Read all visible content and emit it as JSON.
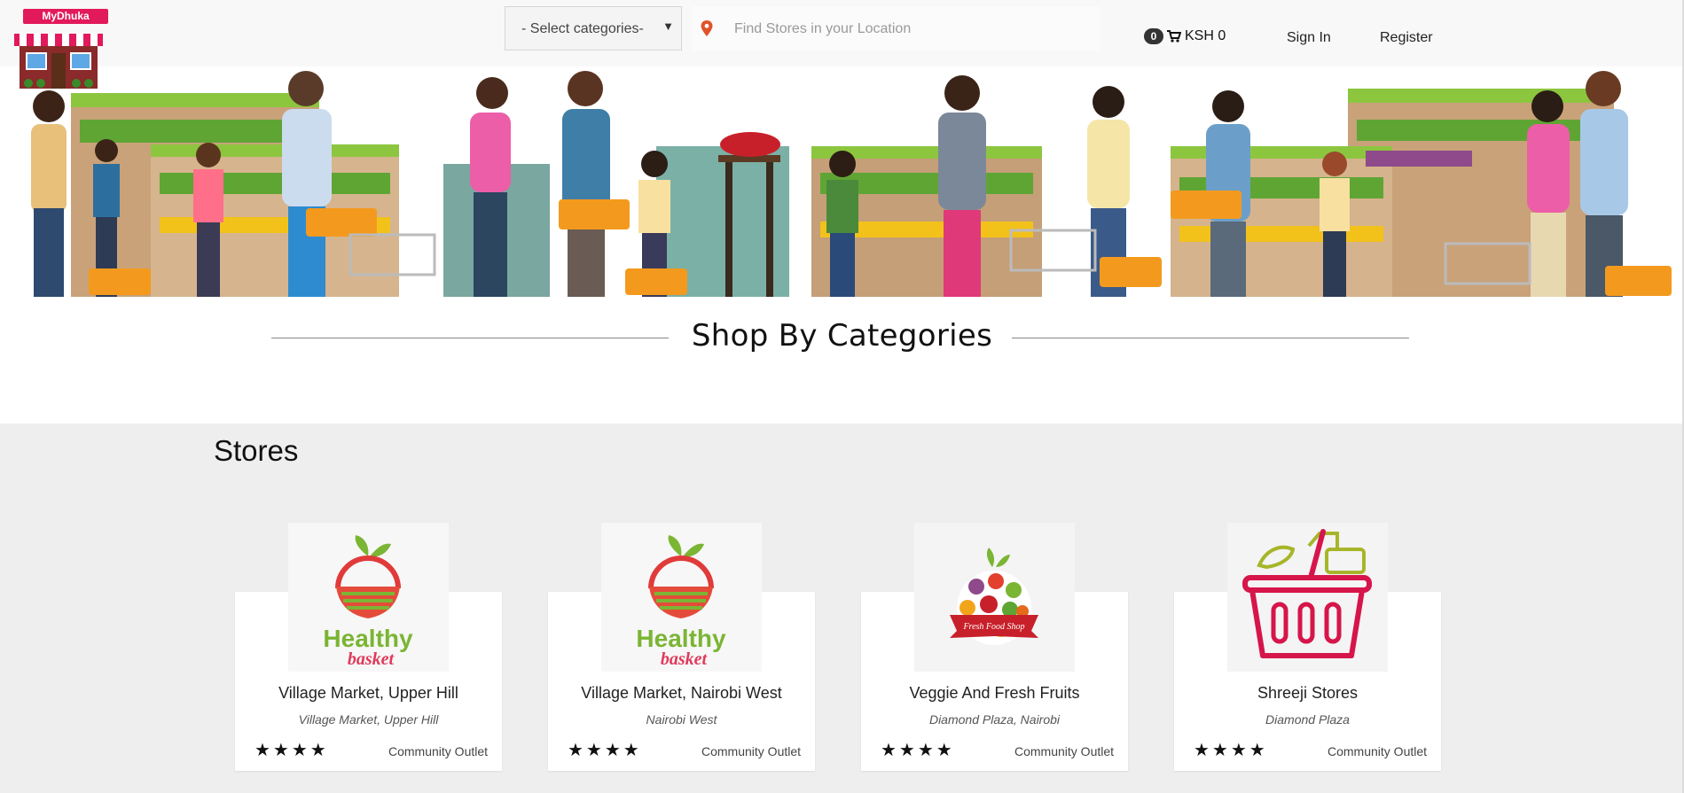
{
  "header": {
    "logo_text": "MyDhuka",
    "category_select": {
      "selected": "- Select categories-"
    },
    "search": {
      "placeholder": "Find Stores in your Location"
    },
    "cart": {
      "count": "0",
      "total": "KSH 0"
    },
    "nav": {
      "sign_in": "Sign In",
      "register": "Register"
    }
  },
  "section": {
    "categories_title": "Shop By Categories"
  },
  "stores": {
    "title": "Stores",
    "items": [
      {
        "name": "Village Market, Upper Hill",
        "location": "Village Market, Upper Hill",
        "rating": "★★★★",
        "category": "Community Outlet",
        "logo": "healthy-basket-logo",
        "logo_text_top": "Healthy",
        "logo_text_bottom": "basket"
      },
      {
        "name": "Village Market, Nairobi West",
        "location": "Nairobi West",
        "rating": "★★★★",
        "category": "Community Outlet",
        "logo": "healthy-basket-logo",
        "logo_text_top": "Healthy",
        "logo_text_bottom": "basket"
      },
      {
        "name": "Veggie And Fresh Fruits",
        "location": "Diamond Plaza, Nairobi",
        "rating": "★★★★",
        "category": "Community Outlet",
        "logo": "fresh-food-shop-logo",
        "logo_text": "Fresh Food Shop"
      },
      {
        "name": "Shreeji Stores",
        "location": "Diamond Plaza",
        "rating": "★★★★",
        "category": "Community Outlet",
        "logo": "shopping-basket-logo"
      }
    ]
  },
  "colors": {
    "brand": "#e2195b",
    "accent_green": "#7bb534",
    "basket_red": "#d6154a",
    "section_bg": "#eeeeee"
  }
}
